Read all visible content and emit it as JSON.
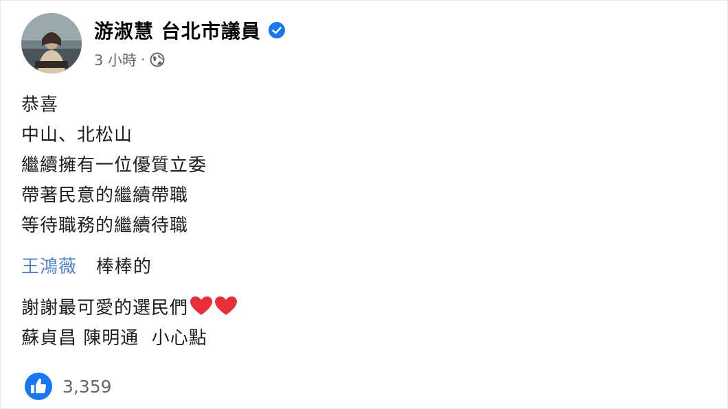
{
  "post": {
    "author": "游淑慧 台北市議員",
    "timestamp": "3 小時",
    "separator": "·",
    "lines": [
      "恭喜",
      "中山、北松山",
      "繼續擁有一位優質立委",
      "帶著民意的繼續帶職",
      "等待職務的繼續待職"
    ],
    "mention_line": {
      "mention": "王鴻薇",
      "text": "棒棒的"
    },
    "thanks": "謝謝最可愛的選民們",
    "closing": "蘇貞昌 陳明通  小心點"
  },
  "reactions": {
    "count": "3,359"
  },
  "icons": {
    "verified": "verified-badge-icon",
    "privacy": "globe-icon",
    "heart": "red-heart-icon",
    "like": "like-thumb-icon"
  },
  "colors": {
    "verified_blue": "#1877f2",
    "mention_blue": "#4e7fd1",
    "heart_red": "#e8303a",
    "meta_gray": "#65676b"
  }
}
